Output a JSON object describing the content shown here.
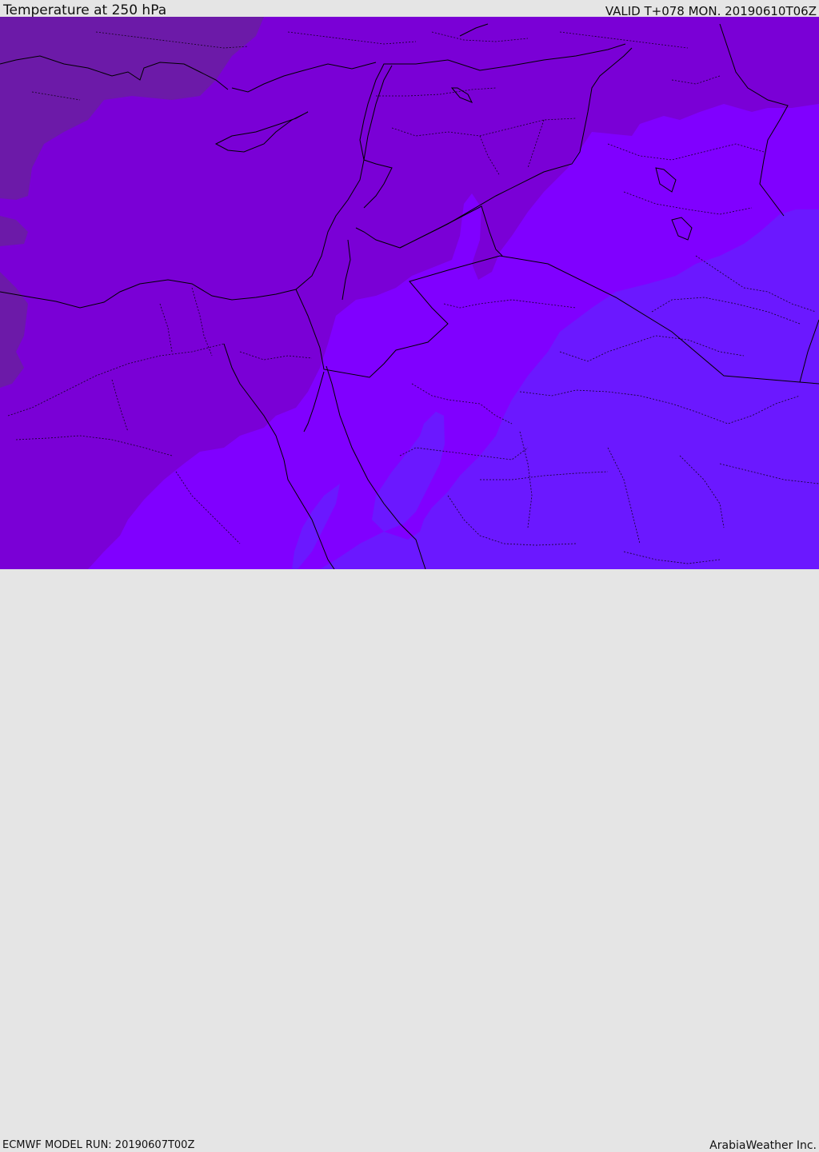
{
  "header": {
    "title": "Temperature at 250 hPa",
    "valid": "VALID T+078 MON. 20190610T06Z"
  },
  "footer": {
    "model_run": "ECMWF MODEL RUN: 20190607T00Z",
    "credit": "ArabiaWeather Inc."
  },
  "map": {
    "field_colors": {
      "coldest": "#6c1aa8",
      "cold": "#7a00d6",
      "mid": "#8000ff",
      "warm": "#6b18ff"
    },
    "border_color": "#000000"
  }
}
